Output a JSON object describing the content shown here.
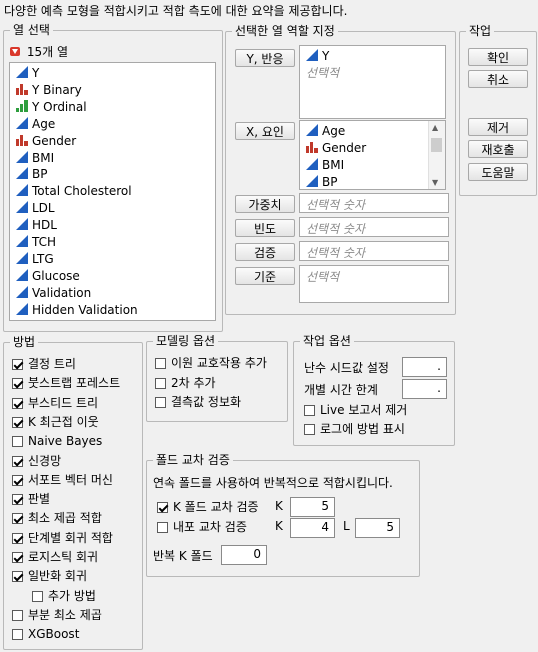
{
  "description": "다양한 예측 모형을 적합시키고 적합 측도에 대한 요약을 제공합니다.",
  "column_select": {
    "title": "열 선택",
    "count_label": "15개 열",
    "columns": [
      {
        "name": "Y",
        "icon": "continuous-icon"
      },
      {
        "name": "Y Binary",
        "icon": "nominal-icon"
      },
      {
        "name": "Y Ordinal",
        "icon": "ordinal-icon"
      },
      {
        "name": "Age",
        "icon": "continuous-icon"
      },
      {
        "name": "Gender",
        "icon": "nominal-icon"
      },
      {
        "name": "BMI",
        "icon": "continuous-icon"
      },
      {
        "name": "BP",
        "icon": "continuous-icon"
      },
      {
        "name": "Total Cholesterol",
        "icon": "continuous-icon"
      },
      {
        "name": "LDL",
        "icon": "continuous-icon"
      },
      {
        "name": "HDL",
        "icon": "continuous-icon"
      },
      {
        "name": "TCH",
        "icon": "continuous-icon"
      },
      {
        "name": "LTG",
        "icon": "continuous-icon"
      },
      {
        "name": "Glucose",
        "icon": "continuous-icon"
      },
      {
        "name": "Validation",
        "icon": "continuous-icon"
      },
      {
        "name": "Hidden Validation",
        "icon": "continuous-icon"
      }
    ]
  },
  "role_assign": {
    "title": "선택한 열 역할 지정",
    "y_button": "Y, 반응",
    "y_values": [
      "Y"
    ],
    "y_placeholder": "선택적",
    "x_button": "X, 요인",
    "x_values": [
      {
        "name": "Age",
        "icon": "continuous-icon"
      },
      {
        "name": "Gender",
        "icon": "nominal-icon"
      },
      {
        "name": "BMI",
        "icon": "continuous-icon"
      },
      {
        "name": "BP",
        "icon": "continuous-icon"
      }
    ],
    "weight_button": "가중치",
    "weight_placeholder": "선택적 숫자",
    "freq_button": "빈도",
    "freq_placeholder": "선택적 숫자",
    "validation_button": "검증",
    "validation_placeholder": "선택적 숫자",
    "by_button": "기준",
    "by_placeholder": "선택적"
  },
  "action": {
    "title": "작업",
    "ok": "확인",
    "cancel": "취소",
    "remove": "제거",
    "recall": "재호출",
    "help": "도움말"
  },
  "method": {
    "title": "방법",
    "items": [
      {
        "label": "결정 트리",
        "checked": true
      },
      {
        "label": "붓스트랩 포레스트",
        "checked": true
      },
      {
        "label": "부스티드 트리",
        "checked": true
      },
      {
        "label": "K 최근접 이웃",
        "checked": true
      },
      {
        "label": "Naive Bayes",
        "checked": false
      },
      {
        "label": "신경망",
        "checked": true
      },
      {
        "label": "서포트 벡터 머신",
        "checked": true
      },
      {
        "label": "판별",
        "checked": true
      },
      {
        "label": "최소 제곱 적합",
        "checked": true
      },
      {
        "label": "단계별 회귀 적합",
        "checked": true
      },
      {
        "label": "로지스틱 회귀",
        "checked": true
      },
      {
        "label": "일반화 회귀",
        "checked": true
      },
      {
        "label": "추가 방법",
        "checked": false
      },
      {
        "label": "부분 최소 제곱",
        "checked": false
      },
      {
        "label": "XGBoost",
        "checked": false
      }
    ]
  },
  "modeling": {
    "title": "모델링 옵션",
    "items": [
      {
        "label": "이원 교호작용 추가",
        "checked": false
      },
      {
        "label": "2차 추가",
        "checked": false
      },
      {
        "label": "결측값 정보화",
        "checked": false
      }
    ]
  },
  "work_options": {
    "title": "작업 옵션",
    "seed_label": "난수 시드값 설정",
    "seed_value": ".",
    "time_label": "개별 시간 한계",
    "time_value": ".",
    "live_label": "Live 보고서 제거",
    "live_checked": false,
    "log_label": "로그에 방법 표시",
    "log_checked": false
  },
  "fold": {
    "title": "폴드 교차 검증",
    "desc": "연속 폴드를 사용하여 반복적으로 적합시킵니다.",
    "kfold_label": "K 폴드 교차 검증",
    "kfold_checked": true,
    "k_label": "K",
    "k_value": "5",
    "nested_label": "내포 교차 검증",
    "nested_checked": false,
    "nested_k_label": "K",
    "nested_k_value": "4",
    "l_label": "L",
    "l_value": "5",
    "repeat_label": "반복 K 폴드",
    "repeat_value": "0"
  },
  "colors": {
    "continuous": "#1f5fbf",
    "nominal": "#c0392b",
    "ordinal": "#2e9e3e"
  }
}
